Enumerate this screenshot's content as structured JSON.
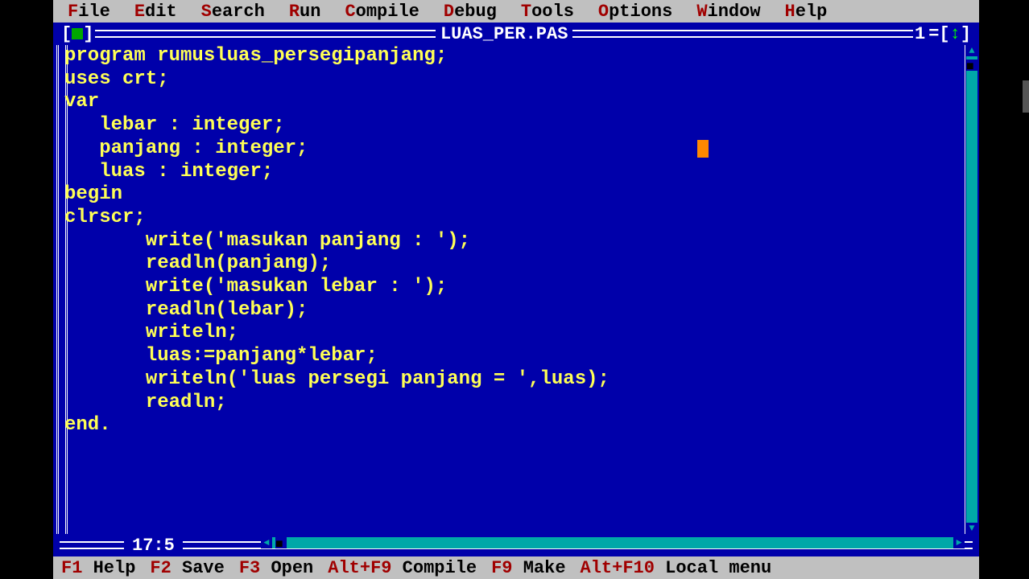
{
  "menus": [
    {
      "hotkey": "F",
      "rest": "ile"
    },
    {
      "hotkey": "E",
      "rest": "dit"
    },
    {
      "hotkey": "S",
      "rest": "earch"
    },
    {
      "hotkey": "R",
      "rest": "un"
    },
    {
      "hotkey": "C",
      "rest": "ompile"
    },
    {
      "hotkey": "D",
      "rest": "ebug"
    },
    {
      "hotkey": "T",
      "rest": "ools"
    },
    {
      "hotkey": "O",
      "rest": "ptions"
    },
    {
      "hotkey": "W",
      "rest": "indow"
    },
    {
      "hotkey": "H",
      "rest": "elp"
    }
  ],
  "window": {
    "title": "LUAS_PER.PAS",
    "number": "1",
    "cursor_pos": "17:5"
  },
  "code_lines": [
    "program rumusluas_persegipanjang;",
    "uses crt;",
    "var",
    "   lebar : integer;",
    "   panjang : integer;",
    "   luas : integer;",
    "begin",
    "clrscr;",
    "       write('masukan panjang : ');",
    "       readln(panjang);",
    "       write('masukan lebar : ');",
    "       readln(lebar);",
    "       writeln;",
    "       luas:=panjang*lebar;",
    "       writeln('luas persegi panjang = ',luas);",
    "       readln;",
    "end."
  ],
  "status": [
    {
      "key": "F1",
      "label": " Help"
    },
    {
      "key": "F2",
      "label": " Save"
    },
    {
      "key": "F3",
      "label": " Open"
    },
    {
      "key": "Alt+F9",
      "label": " Compile"
    },
    {
      "key": "F9",
      "label": " Make"
    },
    {
      "key": "Alt+F10",
      "label": " Local menu"
    }
  ]
}
